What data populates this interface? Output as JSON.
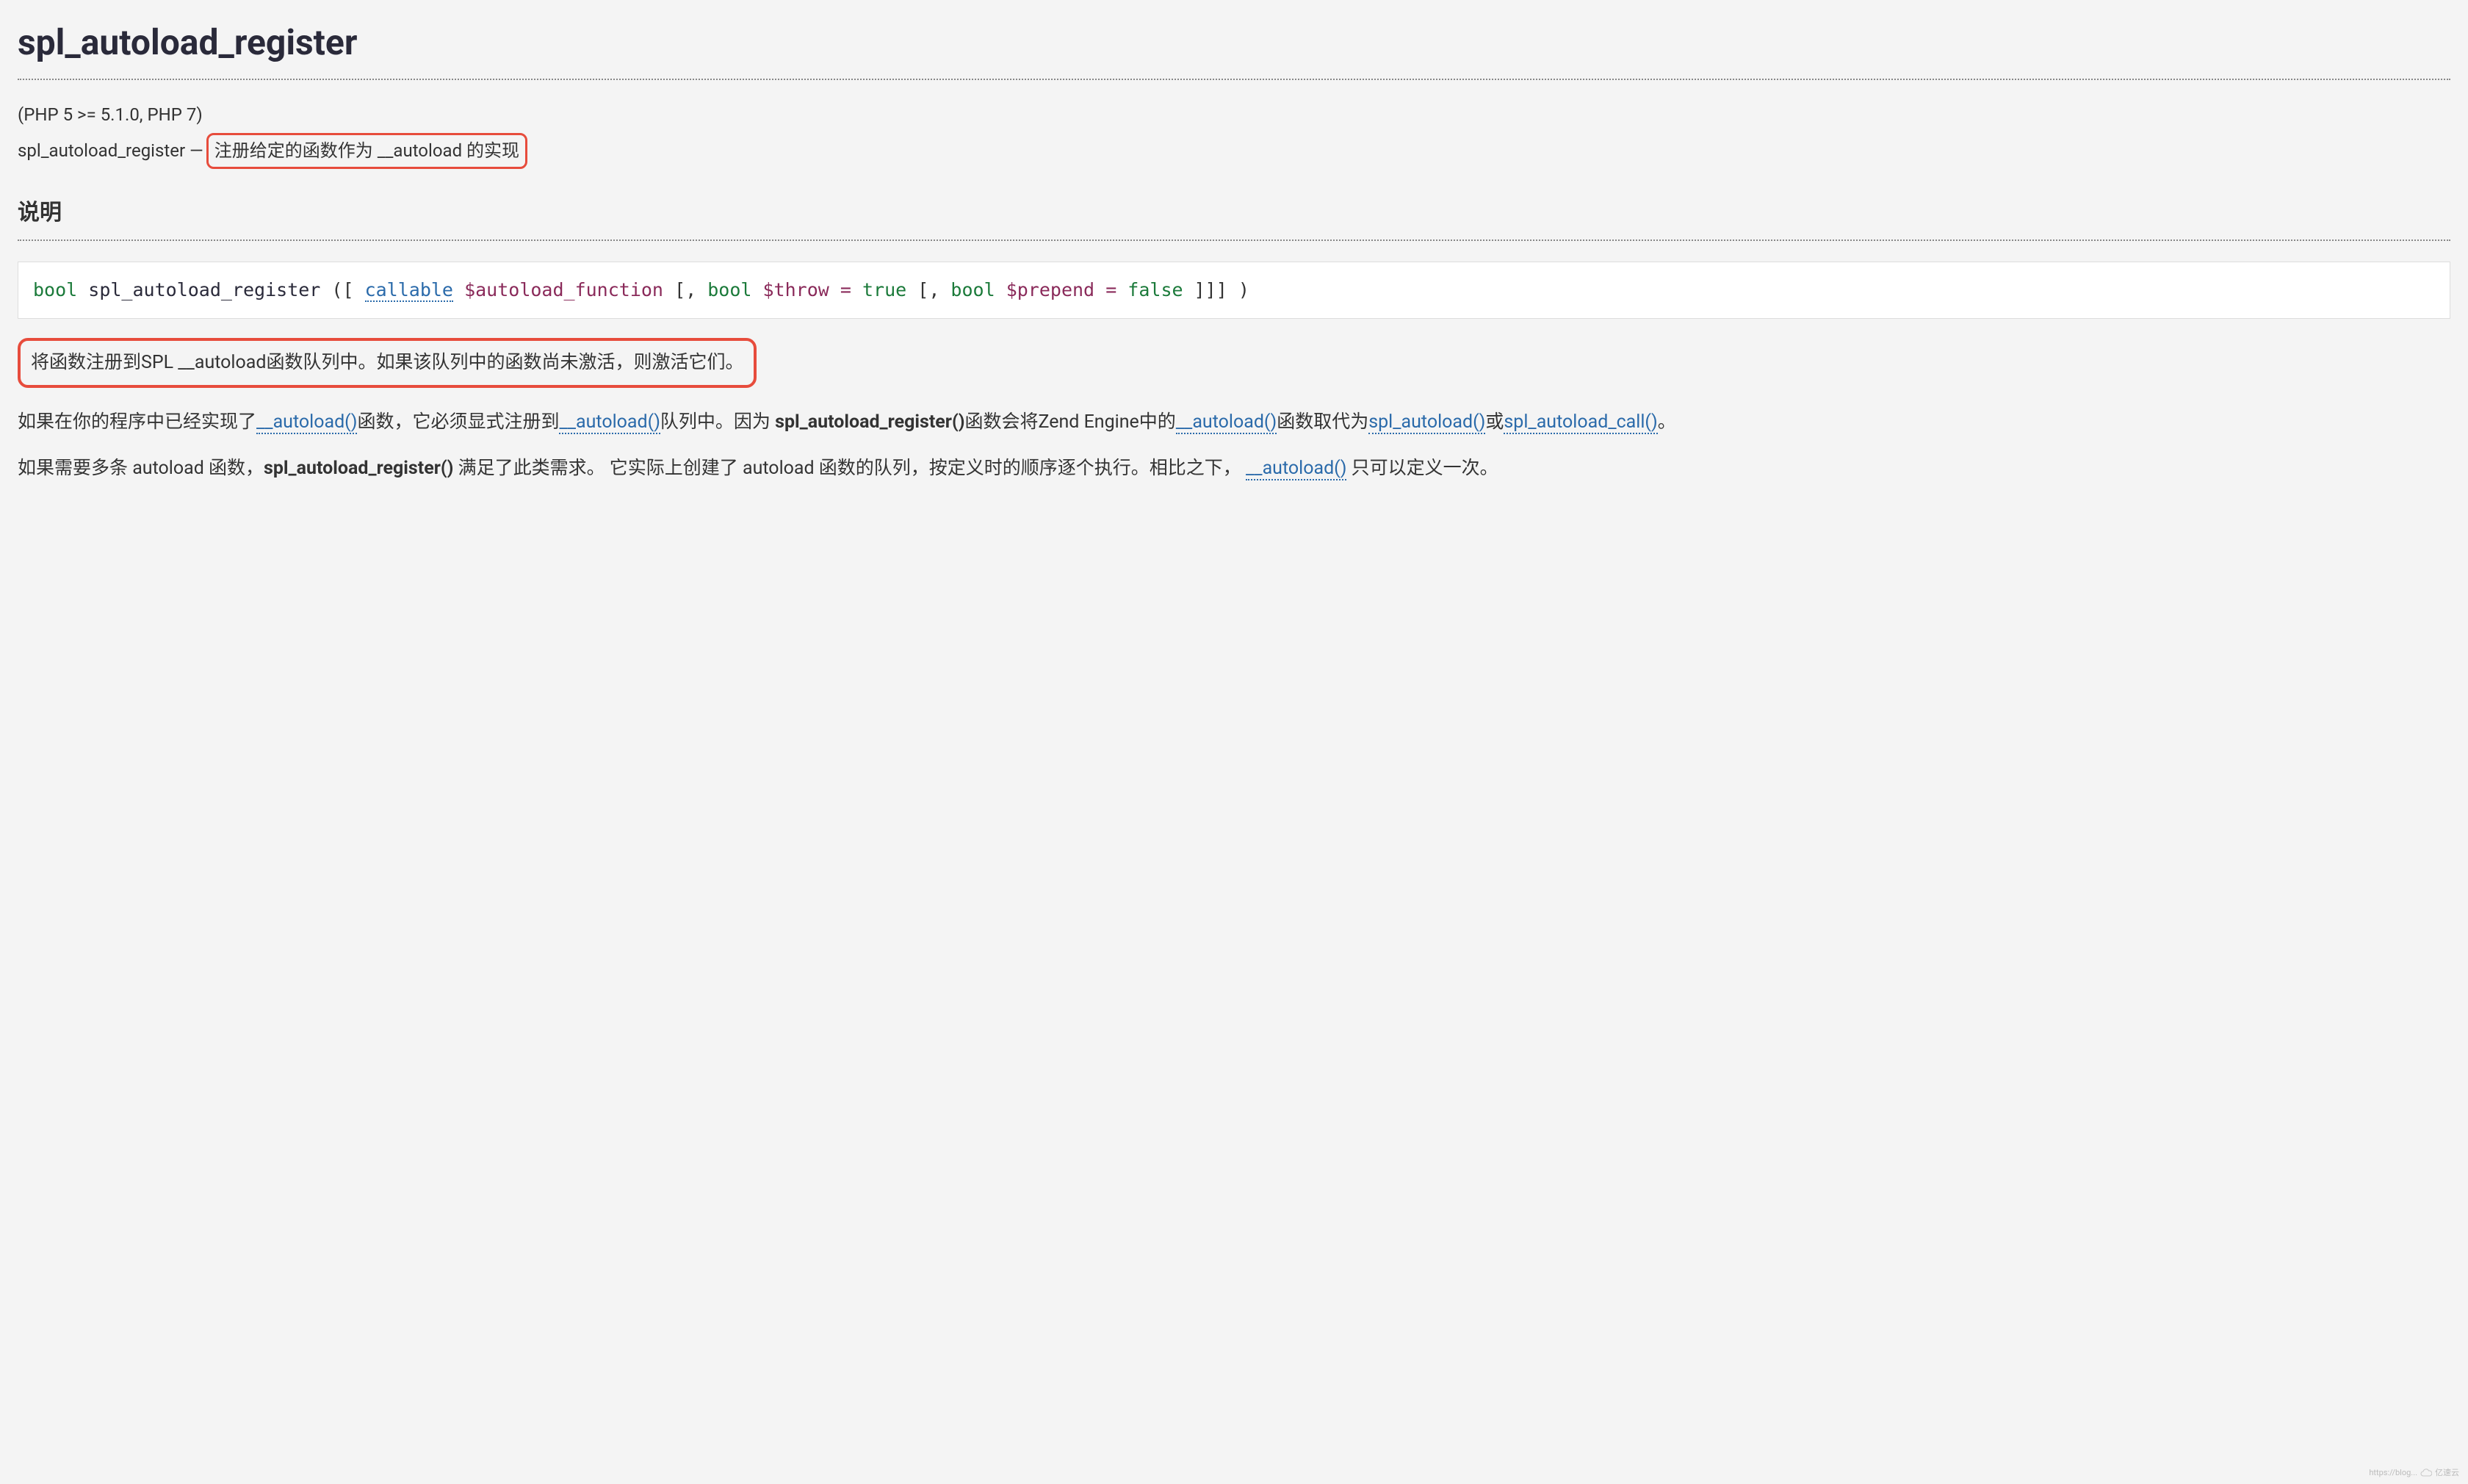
{
  "title": "spl_autoload_register",
  "version": "(PHP 5 >= 5.1.0, PHP 7)",
  "summary_prefix": "spl_autoload_register —",
  "summary_box": "注册给定的函数作为 __autoload 的实现",
  "section_desc": "说明",
  "signature": {
    "ret": "bool",
    "name": "spl_autoload_register",
    "open": " ([ ",
    "callable": "callable",
    "p1": "$autoload_function",
    "sep1": " [, ",
    "t2": "bool",
    "p2": "$throw",
    "eq": " = ",
    "v2": "true",
    "sep2": " [, ",
    "t3": "bool",
    "p3": "$prepend",
    "v3": "false",
    "close": " ]]] )"
  },
  "highlight_para": "将函数注册到SPL __autoload函数队列中。如果该队列中的函数尚未激活，则激活它们。",
  "para2": {
    "t1": "如果在你的程序中已经实现了",
    "l1": "__autoload()",
    "t2": "函数，它必须显式注册到",
    "l2": "__autoload()",
    "t3": "队列中。因为 ",
    "b1": "spl_autoload_register()",
    "t4": "函数会将Zend Engine中的",
    "l3": "__autoload()",
    "t5": "函数取代为",
    "l4": "spl_autoload()",
    "t6": "或",
    "l5": "spl_autoload_call()",
    "t7": "。"
  },
  "para3": {
    "t1": "如果需要多条 autoload 函数，",
    "b1": "spl_autoload_register()",
    "t2": " 满足了此类需求。 它实际上创建了 autoload 函数的队列，按定义时的顺序逐个执行。相比之下， ",
    "l1": "__autoload()",
    "t3": " 只可以定义一次。"
  },
  "watermark": "亿速云"
}
